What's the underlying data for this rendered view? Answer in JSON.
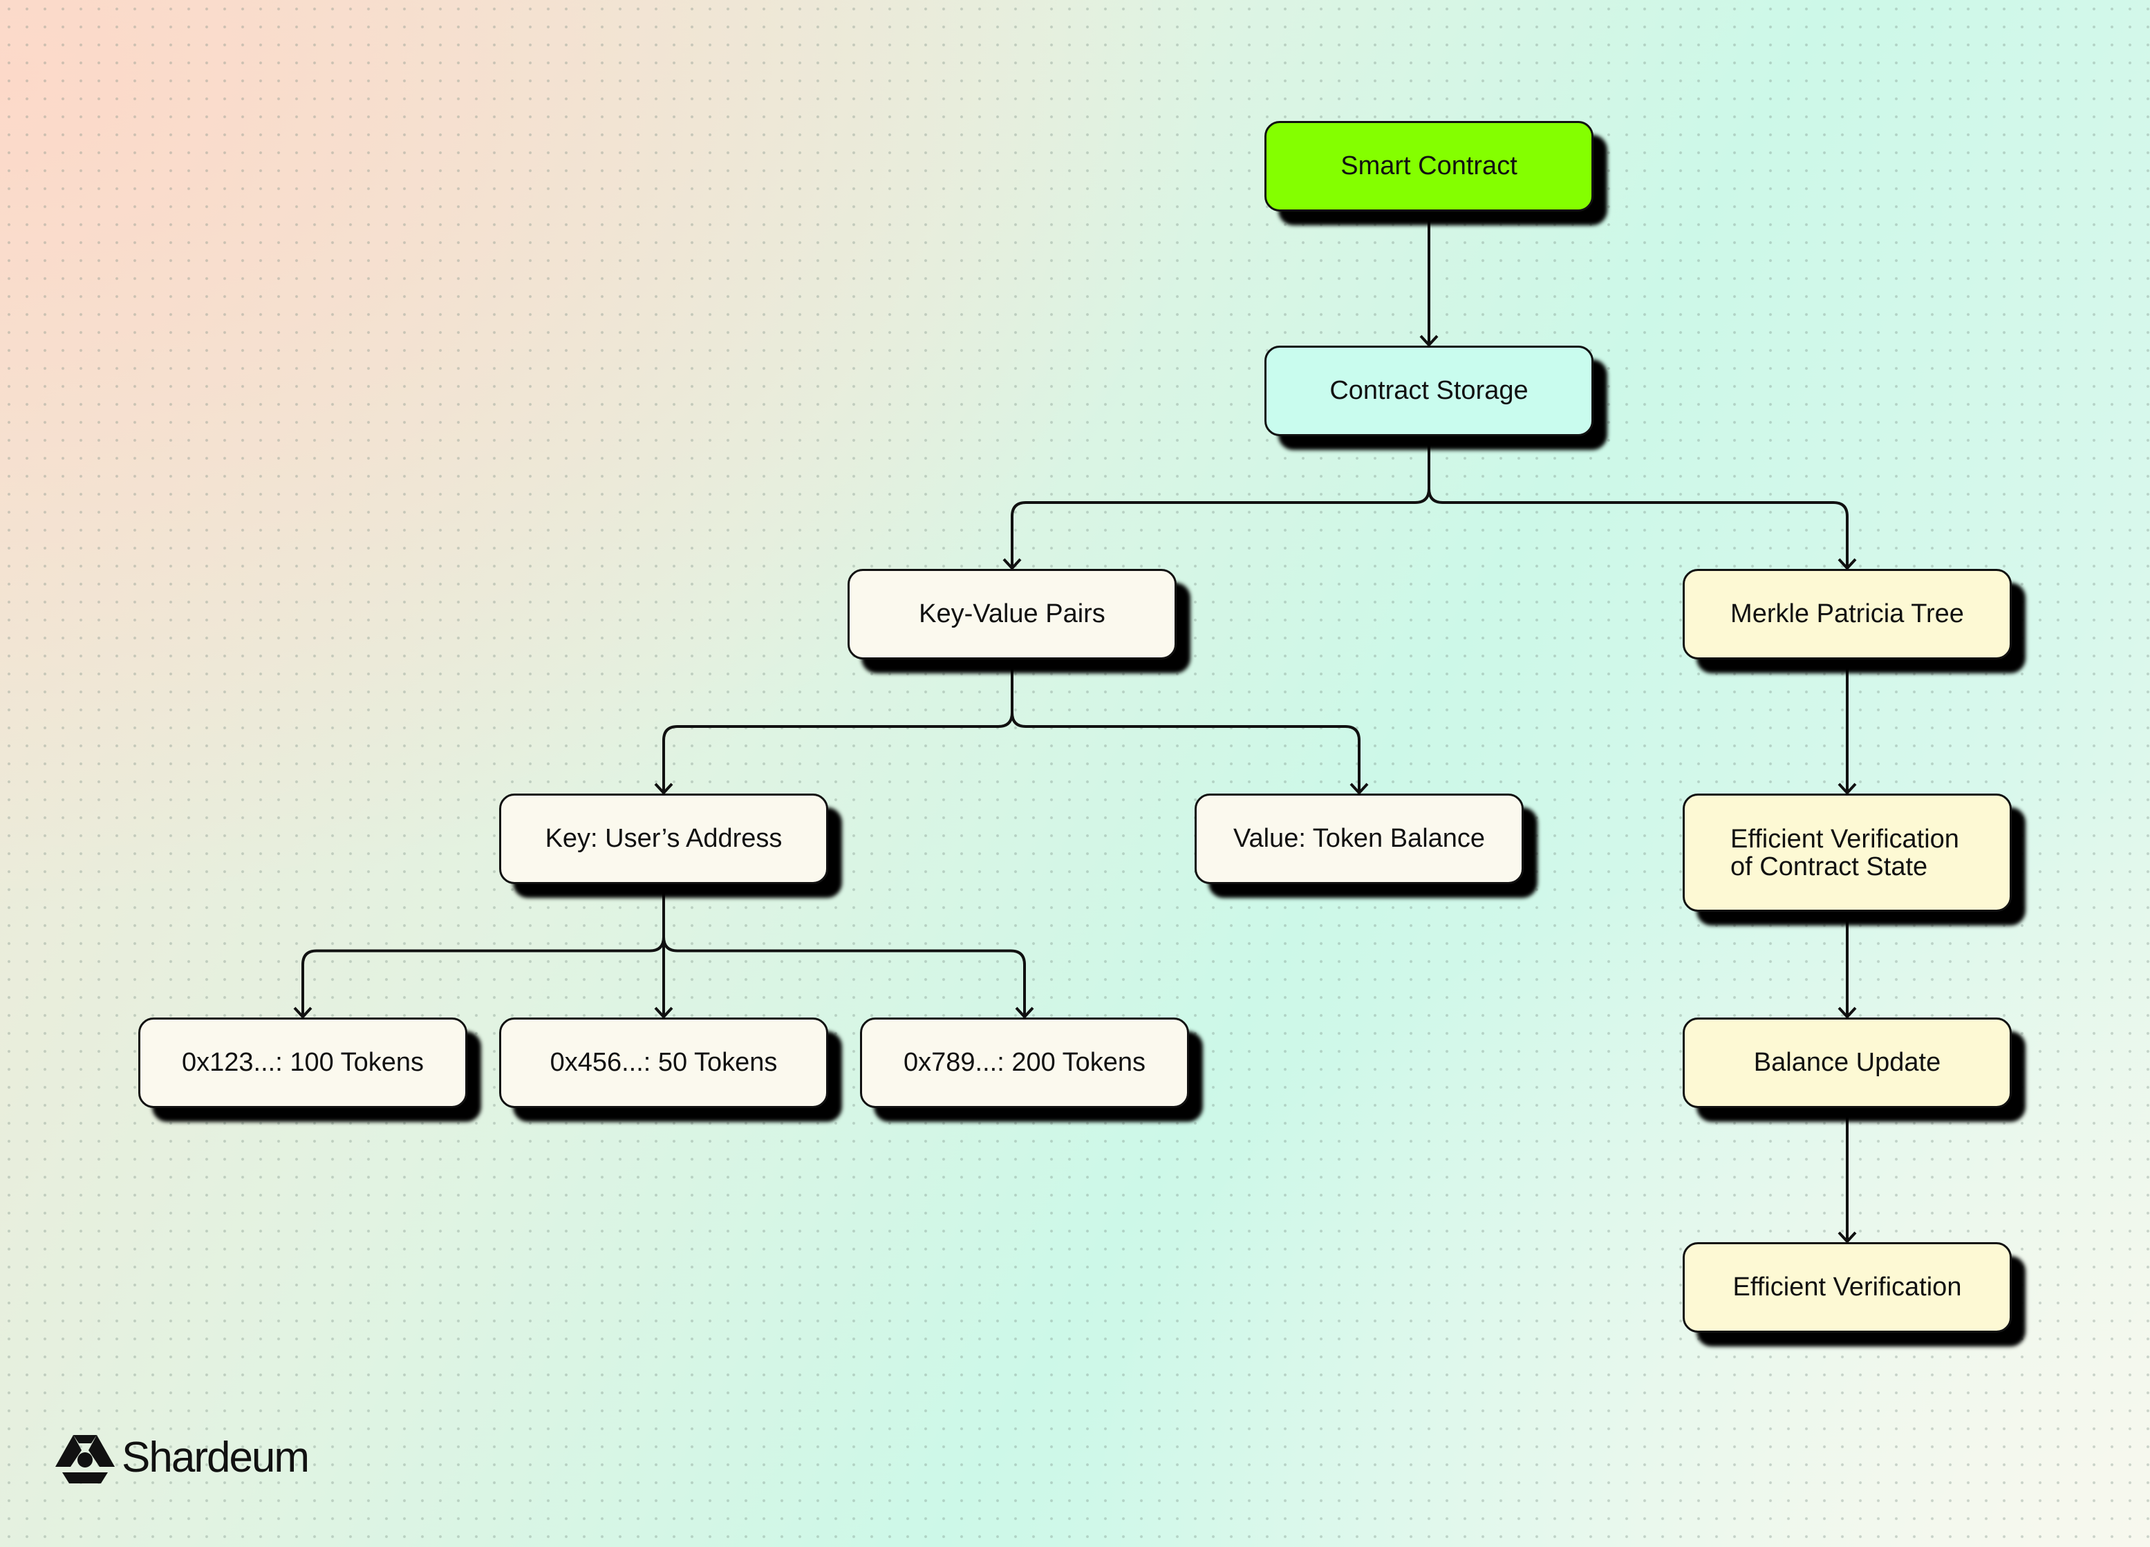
{
  "colors": {
    "primary": "#84ff00",
    "storage": "#c9fcee",
    "data": "#fbf9ee",
    "merkle": "#fdf9d4",
    "line": "#111111"
  },
  "nodes": [
    {
      "id": "smart",
      "label": "Smart Contract",
      "color": "primary"
    },
    {
      "id": "storage",
      "label": "Contract Storage",
      "color": "storage"
    },
    {
      "id": "kv",
      "label": "Key-Value Pairs",
      "color": "data"
    },
    {
      "id": "mpt",
      "label": "Merkle Patricia Tree",
      "color": "merkle"
    },
    {
      "id": "key",
      "label": "Key: User’s Address",
      "color": "data"
    },
    {
      "id": "value",
      "label": "Value: Token Balance",
      "color": "data"
    },
    {
      "id": "evcs",
      "label": "Efficient Verification\nof Contract State",
      "color": "merkle"
    },
    {
      "id": "a1",
      "label": "0x123...: 100 Tokens",
      "color": "data"
    },
    {
      "id": "a2",
      "label": "0x456...: 50 Tokens",
      "color": "data"
    },
    {
      "id": "a3",
      "label": "0x789...: 200 Tokens",
      "color": "data"
    },
    {
      "id": "bal",
      "label": "Balance Update",
      "color": "merkle"
    },
    {
      "id": "ev",
      "label": "Efficient Verification",
      "color": "merkle"
    }
  ],
  "edges": [
    [
      "smart",
      "storage"
    ],
    [
      "storage",
      "kv"
    ],
    [
      "storage",
      "mpt"
    ],
    [
      "kv",
      "key"
    ],
    [
      "kv",
      "value"
    ],
    [
      "key",
      "a1"
    ],
    [
      "key",
      "a2"
    ],
    [
      "key",
      "a3"
    ],
    [
      "mpt",
      "evcs"
    ],
    [
      "evcs",
      "bal"
    ],
    [
      "bal",
      "ev"
    ]
  ],
  "logo": {
    "name": "Shardeum",
    "icon": "shardeum-logo-icon"
  }
}
